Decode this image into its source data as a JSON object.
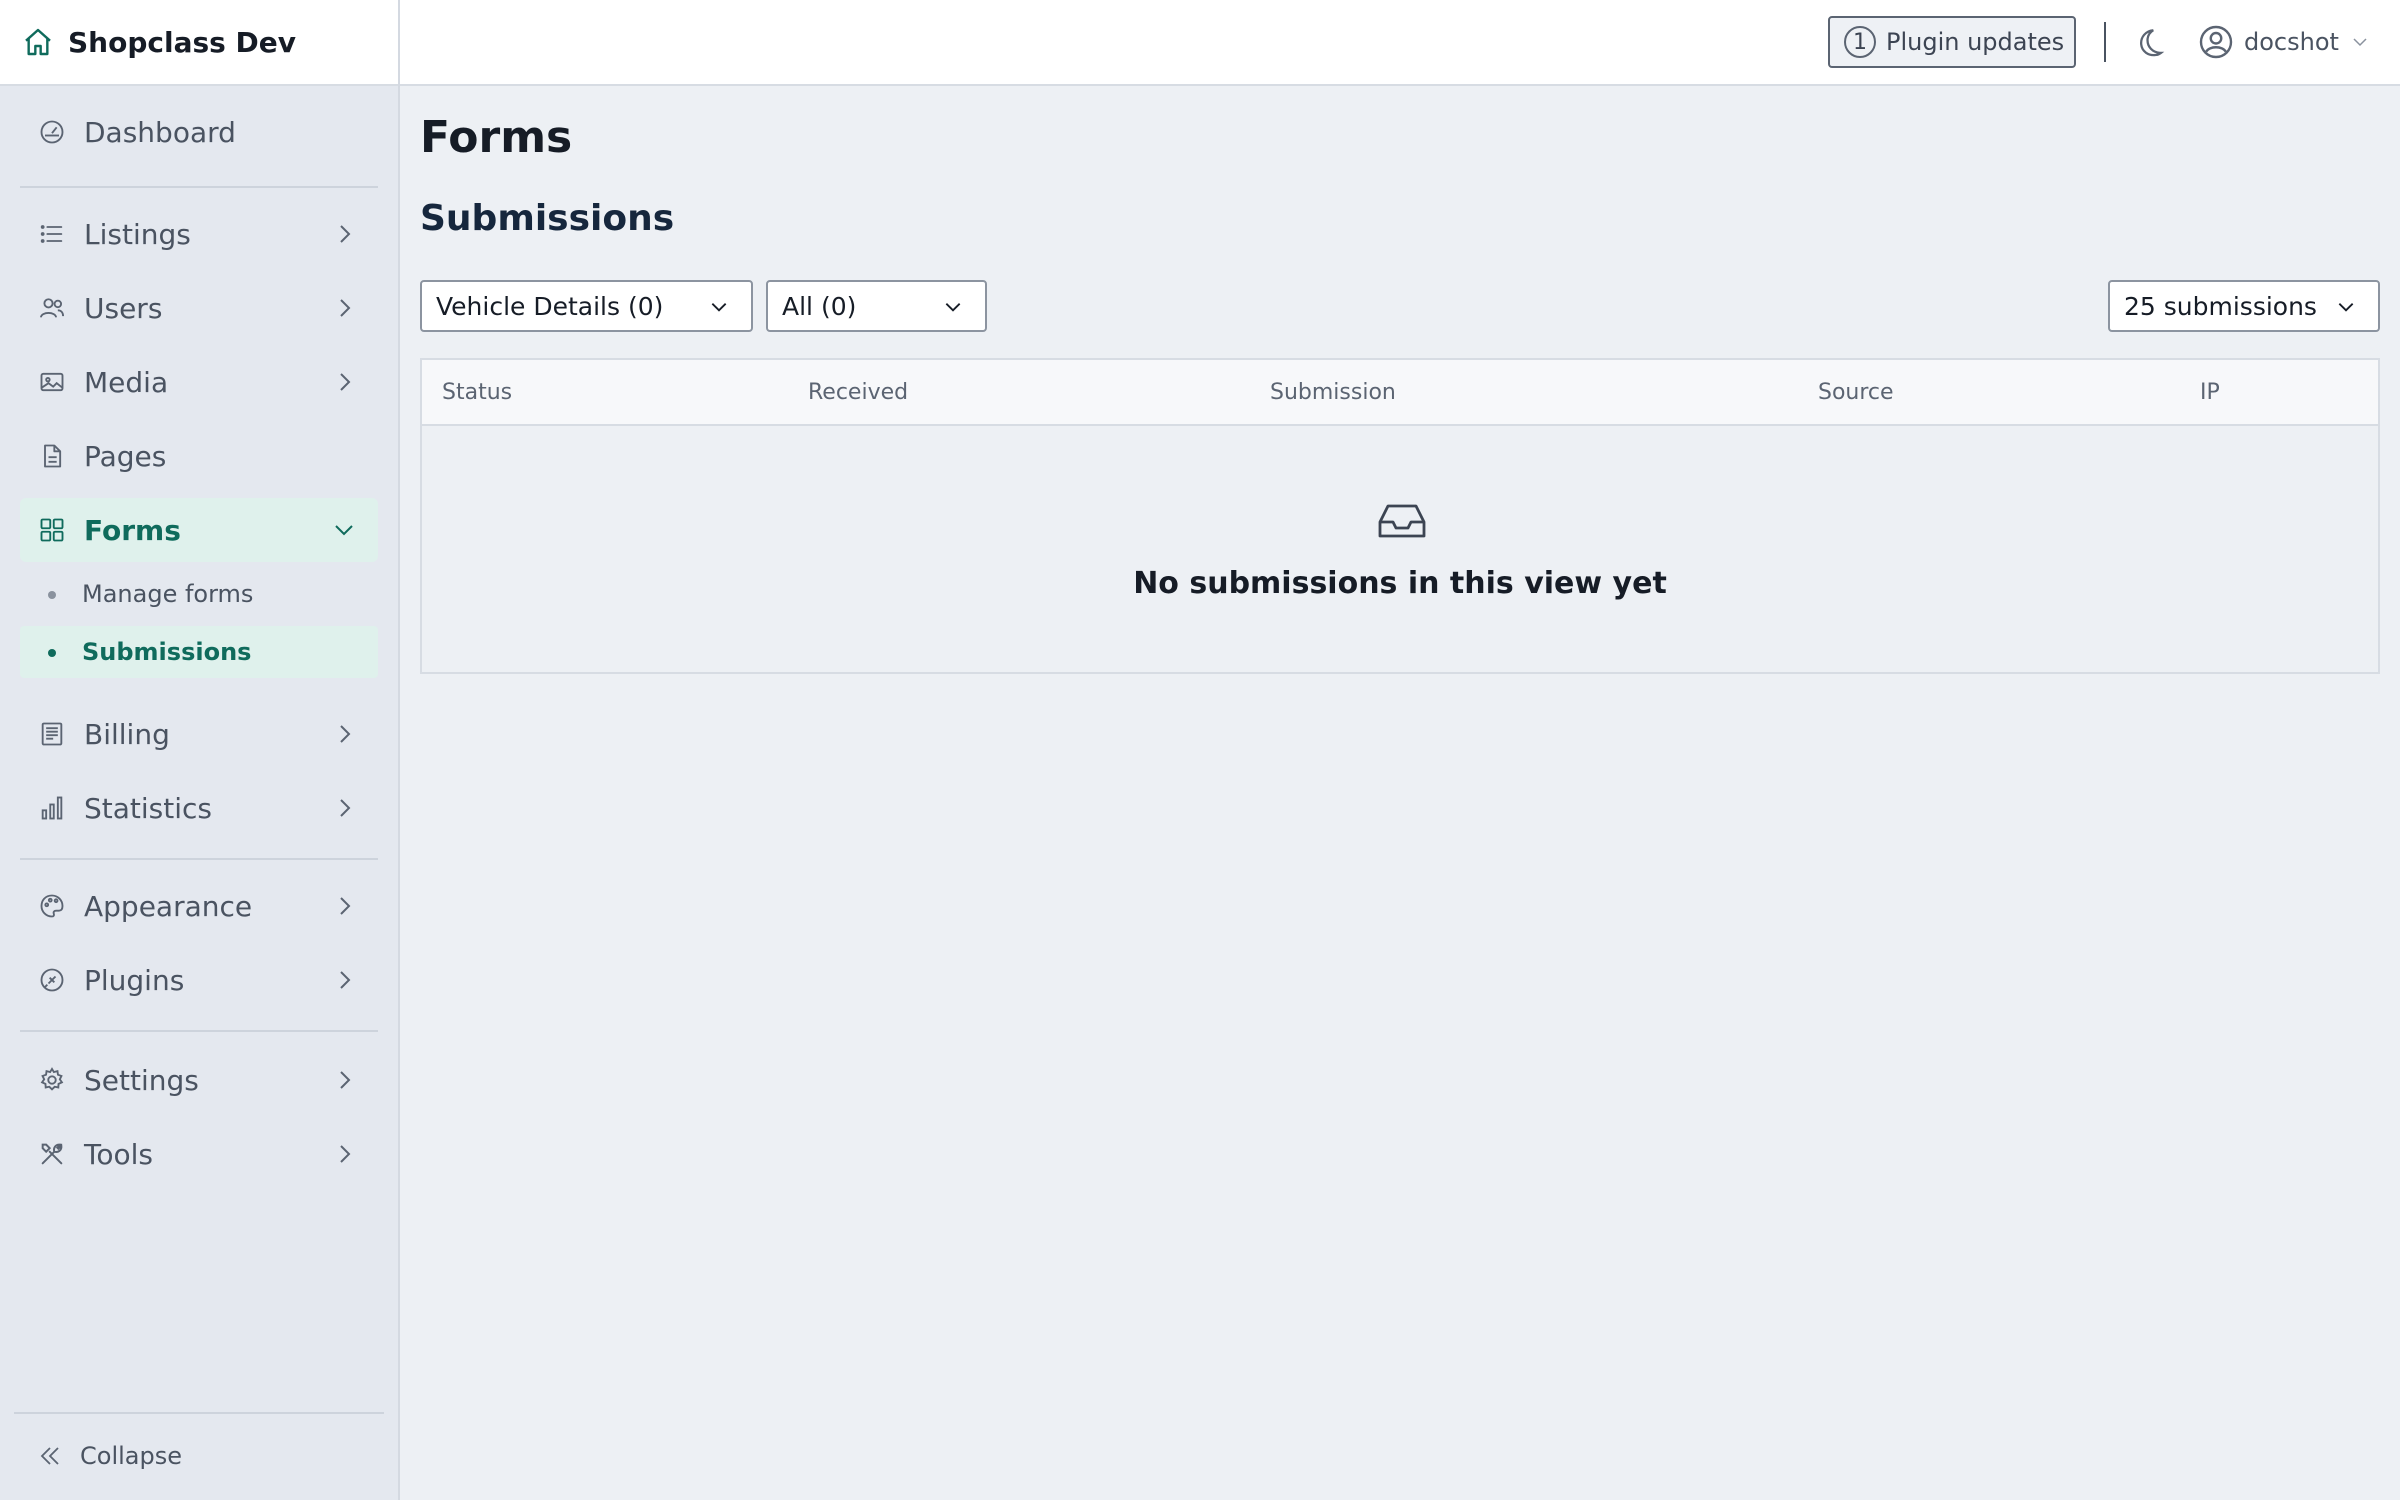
{
  "brand": {
    "title": "Shopclass Dev"
  },
  "topbar": {
    "plugin_updates_count": "1",
    "plugin_updates_label": "Plugin updates",
    "user_name": "docshot"
  },
  "sidebar": {
    "items": [
      {
        "label": "Dashboard"
      },
      {
        "label": "Listings"
      },
      {
        "label": "Users"
      },
      {
        "label": "Media"
      },
      {
        "label": "Pages"
      },
      {
        "label": "Forms"
      },
      {
        "label": "Billing"
      },
      {
        "label": "Statistics"
      },
      {
        "label": "Appearance"
      },
      {
        "label": "Plugins"
      },
      {
        "label": "Settings"
      },
      {
        "label": "Tools"
      }
    ],
    "forms_sub": [
      {
        "label": "Manage forms"
      },
      {
        "label": "Submissions"
      }
    ],
    "collapse_label": "Collapse",
    "active_item": "Forms",
    "active_sub_item": "Submissions"
  },
  "main": {
    "page_title": "Forms",
    "section_title": "Submissions",
    "filters": {
      "form_select": "Vehicle Details (0)",
      "status_select": "All (0)",
      "per_page_select": "25 submissions"
    },
    "table": {
      "columns": [
        "Status",
        "Received",
        "Submission",
        "Source",
        "IP"
      ],
      "rows": [],
      "empty_message": "No submissions in this view yet"
    }
  },
  "colors": {
    "accent": "#0f6b5c",
    "active_bg": "#dff1ec",
    "sidebar_bg": "#e4e8ef",
    "main_bg": "#edf0f4"
  }
}
